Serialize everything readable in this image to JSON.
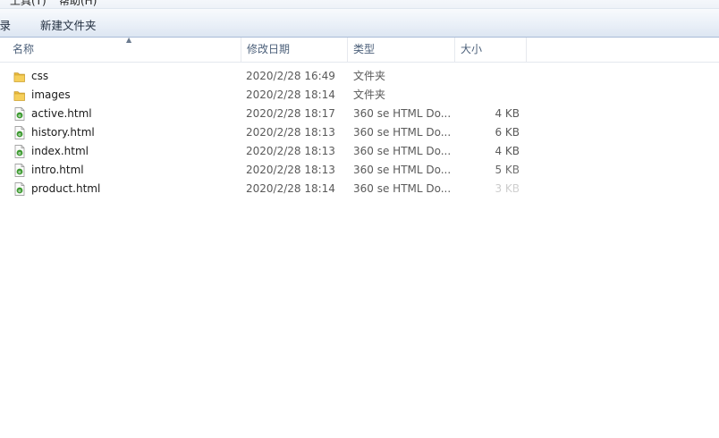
{
  "menubar": {
    "items": [
      "工具(T)",
      "帮助(H)"
    ]
  },
  "toolbar": {
    "left_fragment": "刻录",
    "new_folder": "新建文件夹"
  },
  "columns": {
    "name": "名称",
    "date": "修改日期",
    "type": "类型",
    "size": "大小"
  },
  "files": [
    {
      "name": "css",
      "date": "2020/2/28 16:49",
      "type": "文件夹",
      "size": "",
      "icon": "folder-icon"
    },
    {
      "name": "images",
      "date": "2020/2/28 18:14",
      "type": "文件夹",
      "size": "",
      "icon": "folder-icon"
    },
    {
      "name": "active.html",
      "date": "2020/2/28 18:17",
      "type": "360 se HTML Do...",
      "size": "4 KB",
      "icon": "html-file-icon"
    },
    {
      "name": "history.html",
      "date": "2020/2/28 18:13",
      "type": "360 se HTML Do...",
      "size": "6 KB",
      "icon": "html-file-icon"
    },
    {
      "name": "index.html",
      "date": "2020/2/28 18:13",
      "type": "360 se HTML Do...",
      "size": "4 KB",
      "icon": "html-file-icon"
    },
    {
      "name": "intro.html",
      "date": "2020/2/28 18:13",
      "type": "360 se HTML Do...",
      "size": "5 KB",
      "icon": "html-file-icon"
    },
    {
      "name": "product.html",
      "date": "2020/2/28 18:14",
      "type": "360 se HTML Do...",
      "size": "3 KB",
      "icon": "html-file-icon"
    }
  ],
  "colors": {
    "folder": "#e8b93c",
    "html_icon": "#3c9a2f"
  }
}
